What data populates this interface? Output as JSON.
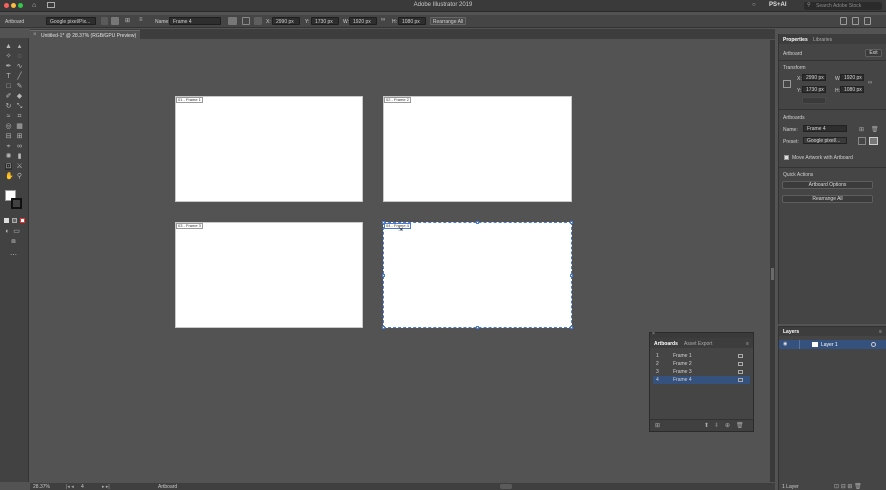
{
  "window": {
    "title": "Adobe Illustrator 2019",
    "workspace": "PS+AI",
    "search_placeholder": "Search Adobe Stock"
  },
  "control_bar": {
    "mode_label": "Artboard",
    "preset_value": "Google pixel/Pix...",
    "name_label": "Name:",
    "name_value": "Frame 4",
    "x_label": "X:",
    "x_value": "2990 px",
    "y_label": "Y:",
    "y_value": "1730 px",
    "w_label": "W:",
    "w_value": "1920 px",
    "h_label": "H:",
    "h_value": "1080 px",
    "rearrange_label": "Rearrange All"
  },
  "document": {
    "tab_title": "Untitled-1* @ 28.37% (RGB/GPU Preview)"
  },
  "artboards": [
    {
      "label": "01 - Frame 1"
    },
    {
      "label": "02 - Frame 2"
    },
    {
      "label": "03 - Frame 3"
    },
    {
      "label": "04 - Frame 4"
    }
  ],
  "status_bar": {
    "zoom": "28.37%",
    "artboard_num": "4",
    "tool_label": "Artboard"
  },
  "properties_panel": {
    "tabs": [
      "Properties",
      "Libraries"
    ],
    "section_title": "Artboard",
    "exit_label": "Exit",
    "transform_title": "Transform",
    "x_label": "X:",
    "x_value": "2990 px",
    "y_label": "Y:",
    "y_value": "1730 px",
    "w_label": "W:",
    "w_value": "1920 px",
    "h_label": "H:",
    "h_value": "1080 px",
    "artboards_title": "Artboards",
    "name_label": "Name:",
    "name_value": "Frame 4",
    "preset_label": "Preset:",
    "preset_value": "Google pixel/...",
    "move_artwork_label": "Move Artwork with Artboard",
    "quick_actions_title": "Quick Actions",
    "artboard_options_label": "Artboard Options",
    "rearrange_label": "Rearrange All"
  },
  "artboards_panel": {
    "tabs": [
      "Artboards",
      "Asset Export"
    ],
    "rows": [
      {
        "num": "1",
        "name": "Frame 1"
      },
      {
        "num": "2",
        "name": "Frame 2"
      },
      {
        "num": "3",
        "name": "Frame 3"
      },
      {
        "num": "4",
        "name": "Frame 4"
      }
    ],
    "selected_index": 3
  },
  "layers_panel": {
    "title": "Layers",
    "layer_name": "Layer 1",
    "footer": "1 Layer"
  },
  "colors": {
    "accent": "#4a7bd0",
    "selection_row": "#35517e"
  }
}
